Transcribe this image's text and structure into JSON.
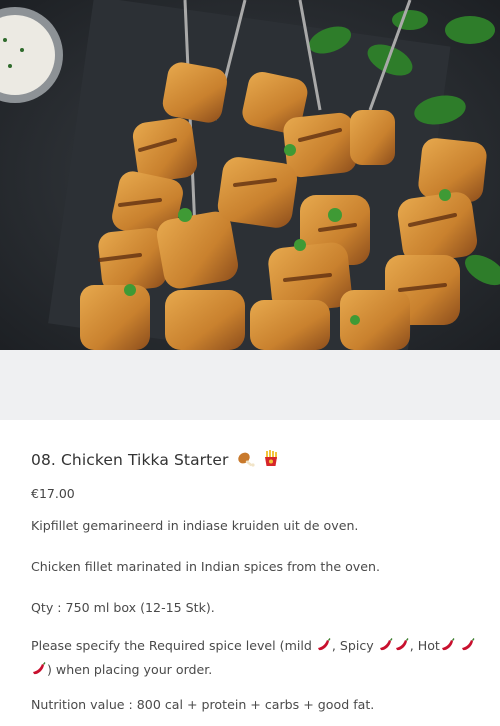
{
  "dish": {
    "title": "08. Chicken Tikka Starter",
    "title_icons": [
      "poultry-leg-icon",
      "fries-icon"
    ],
    "price": "€17.00",
    "description_nl": "Kipfillet gemarineerd in indiase kruiden uit de oven.",
    "description_en": "Chicken fillet marinated in Indian spices from the oven.",
    "quantity": "Qty : 750 ml box (12-15 Stk).",
    "spice_note": {
      "prefix": "Please specify the Required spice level (mild ",
      "spicy": ", Spicy ",
      "hot": ", Hot",
      "suffix": ") when placing your order."
    },
    "nutrition": "Nutrition value : 800 cal + protein + carbs + good fat."
  },
  "colors": {
    "gap_background": "#eff0f2",
    "text": "#333333",
    "chili_red": "#c8102e"
  }
}
